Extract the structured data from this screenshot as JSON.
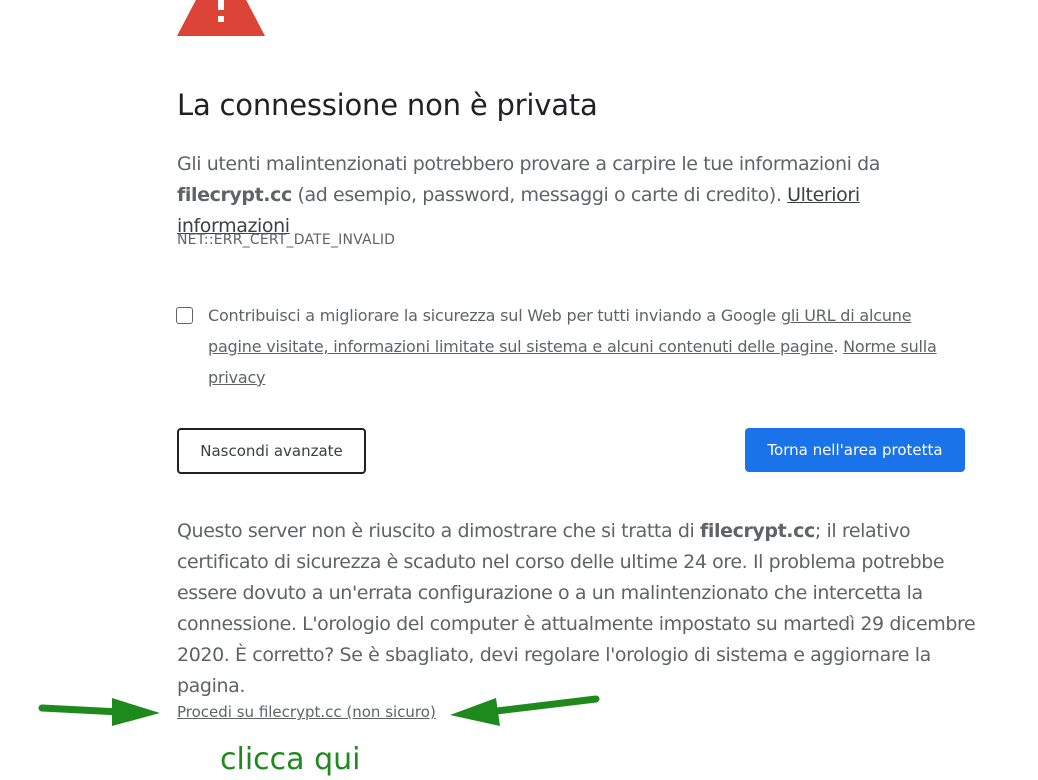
{
  "page": {
    "title": "La connessione non è privata",
    "intro": {
      "before_domain": "Gli utenti malintenzionati potrebbero provare a carpire le tue informazioni da ",
      "domain": "filecrypt.cc",
      "after_domain": " (ad esempio, password, messaggi o carte di credito). ",
      "learn_more_link": "Ulteriori informazioni"
    },
    "error_code": "NET::ERR_CERT_DATE_INVALID",
    "optin": {
      "checked": false,
      "text_before": "Contribuisci a migliorare la sicurezza sul Web per tutti inviando a Google ",
      "data_link": "gli URL di alcune pagine visitate, informazioni limitate sul sistema e alcuni contenuti delle pagine",
      "separator": ". ",
      "privacy_link": "Norme sulla privacy"
    },
    "buttons": {
      "hide_advanced": "Nascondi avanzate",
      "back_to_safety": "Torna nell'area protetta"
    },
    "details": {
      "before_domain": "Questo server non è riuscito a dimostrare che si tratta di ",
      "domain": "filecrypt.cc",
      "after_domain": "; il relativo certificato di sicurezza è scaduto nel corso delle ultime 24 ore. Il problema potrebbe essere dovuto a un'errata configurazione o a un malintenzionato che intercetta la connessione. L'orologio del computer è attualmente impostato su martedì 29 dicembre 2020. È corretto? Se è sbagliato, devi regolare l'orologio di sistema e aggiornare la pagina."
    },
    "proceed_link": "Procedi su filecrypt.cc (non sicuro)"
  },
  "annotation": {
    "text": "clicca qui",
    "color": "#1e8a1e"
  },
  "colors": {
    "warning_red": "#db4437",
    "primary_blue": "#1a73e8",
    "text_gray": "#5f6368",
    "title_dark": "#202124"
  },
  "icons": {
    "warning": "warning-triangle-icon",
    "arrow_left": "arrow-right-icon",
    "arrow_right": "arrow-left-icon"
  }
}
